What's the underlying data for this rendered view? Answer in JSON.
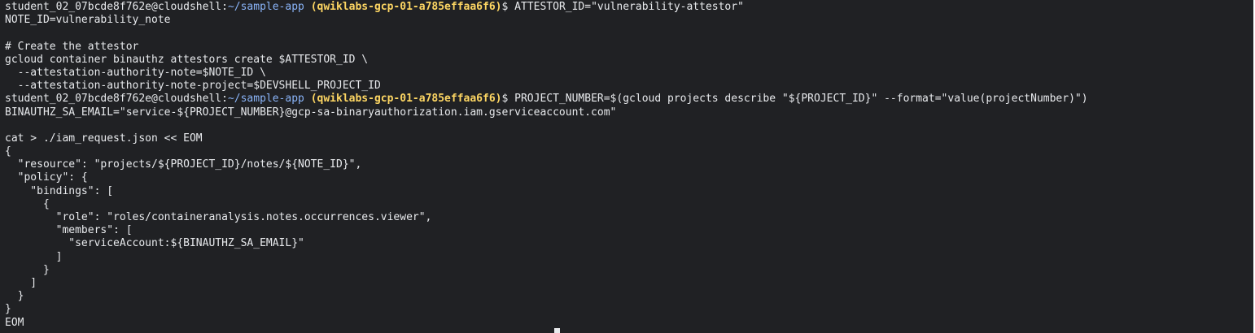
{
  "prompt": {
    "user_host": "student_02_07bcde8f762e@cloudshell:",
    "path": "~/sample-app",
    "project": "(qwiklabs-gcp-01-a785effaa6f6)",
    "symbol": "$"
  },
  "lines": [
    {
      "type": "prompt",
      "command": " ATTESTOR_ID=\"vulnerability-attestor\""
    },
    {
      "type": "text",
      "text": "NOTE_ID=vulnerability_note"
    },
    {
      "type": "text",
      "text": ""
    },
    {
      "type": "text",
      "text": "# Create the attestor"
    },
    {
      "type": "text",
      "text": "gcloud container binauthz attestors create $ATTESTOR_ID \\"
    },
    {
      "type": "text",
      "text": "  --attestation-authority-note=$NOTE_ID \\"
    },
    {
      "type": "text",
      "text": "  --attestation-authority-note-project=$DEVSHELL_PROJECT_ID"
    },
    {
      "type": "prompt",
      "command": " PROJECT_NUMBER=$(gcloud projects describe \"${PROJECT_ID}\" --format=\"value(projectNumber)\")"
    },
    {
      "type": "text",
      "text": "BINAUTHZ_SA_EMAIL=\"service-${PROJECT_NUMBER}@gcp-sa-binaryauthorization.iam.gserviceaccount.com\""
    },
    {
      "type": "text",
      "text": ""
    },
    {
      "type": "text",
      "text": "cat > ./iam_request.json << EOM"
    },
    {
      "type": "text",
      "text": "{"
    },
    {
      "type": "text",
      "text": "  \"resource\": \"projects/${PROJECT_ID}/notes/${NOTE_ID}\","
    },
    {
      "type": "text",
      "text": "  \"policy\": {"
    },
    {
      "type": "text",
      "text": "    \"bindings\": ["
    },
    {
      "type": "text",
      "text": "      {"
    },
    {
      "type": "text",
      "text": "        \"role\": \"roles/containeranalysis.notes.occurrences.viewer\","
    },
    {
      "type": "text",
      "text": "        \"members\": ["
    },
    {
      "type": "text",
      "text": "          \"serviceAccount:${BINAUTHZ_SA_EMAIL}\""
    },
    {
      "type": "text",
      "text": "        ]"
    },
    {
      "type": "text",
      "text": "      }"
    },
    {
      "type": "text",
      "text": "    ]"
    },
    {
      "type": "text",
      "text": "  }"
    },
    {
      "type": "text",
      "text": "}"
    },
    {
      "type": "text",
      "text": "EOM"
    }
  ],
  "colors": {
    "background": "#202124",
    "text": "#e8eaed",
    "path": "#8ab4f8",
    "project": "#fdd663"
  }
}
